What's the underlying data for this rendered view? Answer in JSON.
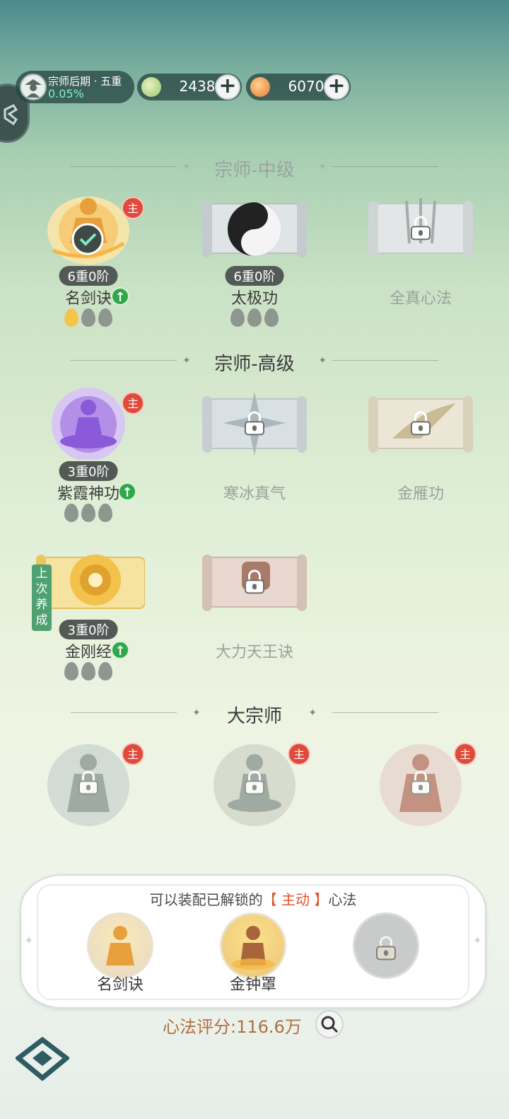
{
  "header": {
    "rank_title": "宗师后期 · 五重",
    "rank_progress": "0.05%",
    "currency1": {
      "value": "2438",
      "icon": "jade-drop-icon",
      "plus": "+"
    },
    "currency2": {
      "value": "6070",
      "icon": "orange-swirl-icon",
      "plus": "+"
    }
  },
  "sections": {
    "mid": "宗师-中级",
    "high": "宗师-高级",
    "grand": "大宗师"
  },
  "skills": {
    "mingjianjue": {
      "name": "名剑诀",
      "stage": "6重0阶",
      "main": "主"
    },
    "taiji": {
      "name": "太极功",
      "stage": "6重0阶"
    },
    "quanzhen": {
      "name": "全真心法"
    },
    "zixia": {
      "name": "紫霞神功",
      "stage": "3重0阶",
      "main": "主"
    },
    "hanbing": {
      "name": "寒冰真气"
    },
    "jinyan": {
      "name": "金雁功"
    },
    "jingang": {
      "name": "金刚经",
      "stage": "3重0阶",
      "tag": "上次养成"
    },
    "dali": {
      "name": "大力天王诀"
    },
    "grand1": {
      "main": "主"
    },
    "grand2": {
      "main": "主"
    },
    "grand3": {
      "main": "主"
    }
  },
  "loadout": {
    "hint_prefix": "可以装配已解锁的",
    "hint_highlight": "【 主动 】",
    "hint_suffix": "心法",
    "slot1": "名剑诀",
    "slot2": "金钟罩"
  },
  "score": "心法评分:116.6万",
  "colors": {
    "accent": "#e04a3b",
    "upgrade": "#2fa84a",
    "score": "#b0703f"
  }
}
